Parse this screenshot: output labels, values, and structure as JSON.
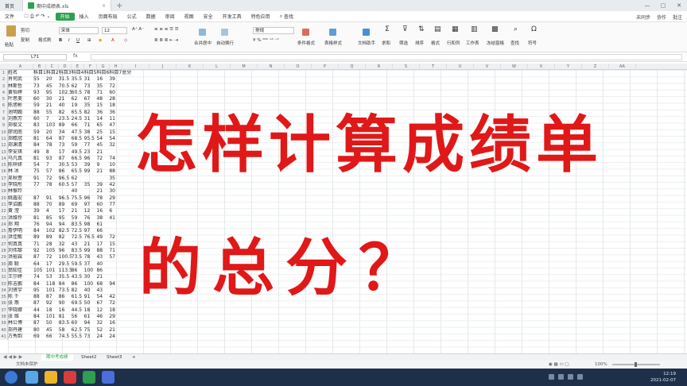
{
  "titlebar": {
    "home_tab": "首页",
    "doc_tab": "期中成绩表.xls",
    "close": "×",
    "add": "+",
    "win_min": "—",
    "win_max": "▢",
    "win_close": "✕"
  },
  "menubar": {
    "file": "文件",
    "items": [
      "开始",
      "插入",
      "页面布局",
      "公式",
      "数据",
      "审阅",
      "视图",
      "安全",
      "开发工具",
      "特色应用"
    ],
    "search": "查找",
    "sync": "未同步",
    "share": "协作",
    "annotate": "批注"
  },
  "ribbon": {
    "paste": "粘贴",
    "cut": "剪切",
    "copy": "复制",
    "format_painter": "格式刷",
    "font": "宋体",
    "font_size": "12",
    "merge_center": "合并居中",
    "auto_wrap": "自动换行",
    "number_format": "常规",
    "cond_format": "条件格式",
    "table_style": "表格样式",
    "doc_helper": "文档助手",
    "sum": "求和",
    "filter": "筛选",
    "sort": "排序",
    "format": "格式",
    "row_col": "行和列",
    "worksheet": "工作表",
    "freeze": "冻结窗格",
    "find": "查找",
    "symbol": "符号"
  },
  "formula_bar": {
    "name_box": "L71",
    "fx": "fx",
    "value": ""
  },
  "columns": [
    "A",
    "B",
    "C",
    "D",
    "E",
    "F",
    "G",
    "H",
    "I",
    "J",
    "K",
    "L",
    "M",
    "N",
    "O",
    "P",
    "Q",
    "R",
    "S",
    "T",
    "U",
    "V",
    "W",
    "X",
    "Y",
    "Z",
    "AA"
  ],
  "rows": [
    [
      "姓名",
      "科目1",
      "科目2",
      "科目3",
      "科目4",
      "科目5",
      "科目6",
      "科目7",
      "总分"
    ],
    [
      "肖何武",
      "55",
      "20",
      "31.5",
      "35.5",
      "31",
      "16",
      "39",
      ""
    ],
    [
      "林斯哲",
      "73",
      "45",
      "70.5",
      "62",
      "73",
      "35",
      "72",
      ""
    ],
    [
      "黄怡婷",
      "93",
      "95",
      "102.5",
      "60.5",
      "78",
      "71",
      "60",
      ""
    ],
    [
      "叶思美",
      "60",
      "30",
      "21",
      "62",
      "67",
      "48",
      "28",
      ""
    ],
    [
      "陈旭彬",
      "59",
      "21",
      "40",
      "19",
      "35",
      "15",
      "18",
      ""
    ],
    [
      "池明翰",
      "88",
      "55",
      "82",
      "65.5",
      "82",
      "36",
      "36",
      ""
    ],
    [
      "刘燕芳",
      "60",
      "7",
      "23.5",
      "24.5",
      "31",
      "14",
      "11",
      ""
    ],
    [
      "郑俊文",
      "83",
      "103",
      "89",
      "66",
      "71",
      "65",
      "47",
      ""
    ],
    [
      "廖润南",
      "59",
      "20",
      "34",
      "47.5",
      "38",
      "25",
      "15",
      ""
    ],
    [
      "郑瞻冠",
      "81",
      "64",
      "87",
      "68.5",
      "95.5",
      "54",
      "54",
      ""
    ],
    [
      "郑渊清",
      "84",
      "78",
      "73",
      "59",
      "77",
      "45",
      "32",
      ""
    ],
    [
      "李安琪",
      "49",
      "8",
      "17",
      "49.5",
      "23",
      "21",
      "",
      ""
    ],
    [
      "马凡真",
      "81",
      "93",
      "87",
      "66.5",
      "96",
      "72",
      "74",
      ""
    ],
    [
      "陈梓妍",
      "54",
      "7",
      "30.5",
      "53",
      "39",
      "9",
      "10",
      ""
    ],
    [
      "林 冰",
      "75",
      "57",
      "86",
      "65.5",
      "99",
      "21",
      "88",
      ""
    ],
    [
      "吴秋萱",
      "91",
      "72",
      "96.5",
      "62",
      "",
      "",
      "35",
      ""
    ],
    [
      "李晓彤",
      "77",
      "78",
      "60.5",
      "57",
      "35",
      "39",
      "42",
      ""
    ],
    [
      "林振玲",
      "",
      "",
      "",
      "40",
      "",
      "21",
      "30",
      ""
    ],
    [
      "姚鑫宏",
      "87",
      "91",
      "96.5",
      "75.5",
      "96",
      "78",
      "29",
      ""
    ],
    [
      "李诏鹏",
      "88",
      "70",
      "89",
      "69",
      "97",
      "60",
      "77",
      ""
    ],
    [
      "黄 滢",
      "39",
      "4",
      "17",
      "21",
      "12",
      "16",
      "6",
      ""
    ],
    [
      "洪维伶",
      "81",
      "85",
      "95",
      "59",
      "76",
      "38",
      "41",
      ""
    ],
    [
      "郑 翔",
      "76",
      "94",
      "94",
      "83.5",
      "98",
      "61",
      "",
      ""
    ],
    [
      "詹伊明",
      "84",
      "102",
      "82.5",
      "72.5",
      "97",
      "66",
      "",
      ""
    ],
    [
      "洪佳敏",
      "89",
      "89",
      "82",
      "72.5",
      "76.5",
      "49",
      "72",
      ""
    ],
    [
      "何真真",
      "71",
      "28",
      "32",
      "43",
      "21",
      "17",
      "15",
      ""
    ],
    [
      "刘伟黎",
      "92",
      "105",
      "96",
      "83.5",
      "99",
      "88",
      "71",
      ""
    ],
    [
      "洪裕霖",
      "87",
      "72",
      "100.5",
      "73.5",
      "78",
      "43",
      "57",
      ""
    ],
    [
      "周 聪",
      "64",
      "17",
      "29.5",
      "59.5",
      "37",
      "40",
      "",
      ""
    ],
    [
      "翁知佳",
      "105",
      "101",
      "113.5",
      "86",
      "100",
      "86",
      "",
      ""
    ],
    [
      "王尔婷",
      "74",
      "53",
      "35.5",
      "43.5",
      "30",
      "21",
      "",
      ""
    ],
    [
      "陈吉鹏",
      "84",
      "118",
      "84",
      "86",
      "100",
      "68",
      "94",
      ""
    ],
    [
      "刘贤宇",
      "95",
      "101",
      "73.5",
      "82",
      "40",
      "43",
      "",
      ""
    ],
    [
      "陈 千",
      "88",
      "87",
      "86",
      "61.5",
      "91",
      "54",
      "42",
      ""
    ],
    [
      "张 燕",
      "87",
      "92",
      "90",
      "69.5",
      "50",
      "67",
      "72",
      ""
    ],
    [
      "李晓娜",
      "44",
      "18",
      "16",
      "44.5",
      "18",
      "12",
      "18",
      ""
    ],
    [
      "张 维",
      "84",
      "101",
      "81",
      "56",
      "61",
      "46",
      "29",
      ""
    ],
    [
      "林公博",
      "87",
      "50",
      "83.5",
      "60",
      "94",
      "32",
      "16",
      ""
    ],
    [
      "郑丹建",
      "80",
      "45",
      "58",
      "62.5",
      "75",
      "52",
      "21",
      ""
    ],
    [
      "方秀韵",
      "69",
      "66",
      "74.5",
      "55.5",
      "73",
      "24",
      "24",
      ""
    ]
  ],
  "overlay": {
    "line1": "怎样计算成绩单",
    "line2": "的总分？"
  },
  "sheets": {
    "nav": "◀ ◀ ▶ ▶",
    "tabs": [
      "期中考成绩",
      "Sheet2",
      "Sheet3"
    ],
    "add": "+"
  },
  "status": {
    "left": "文档未保护",
    "zoom": "100%"
  },
  "taskbar": {
    "time": "12:19",
    "date": "2021-02-07"
  },
  "colors": {
    "accent": "#2e9e4f",
    "overlay_red": "#e01818",
    "taskbar": "#1e2f4a"
  }
}
